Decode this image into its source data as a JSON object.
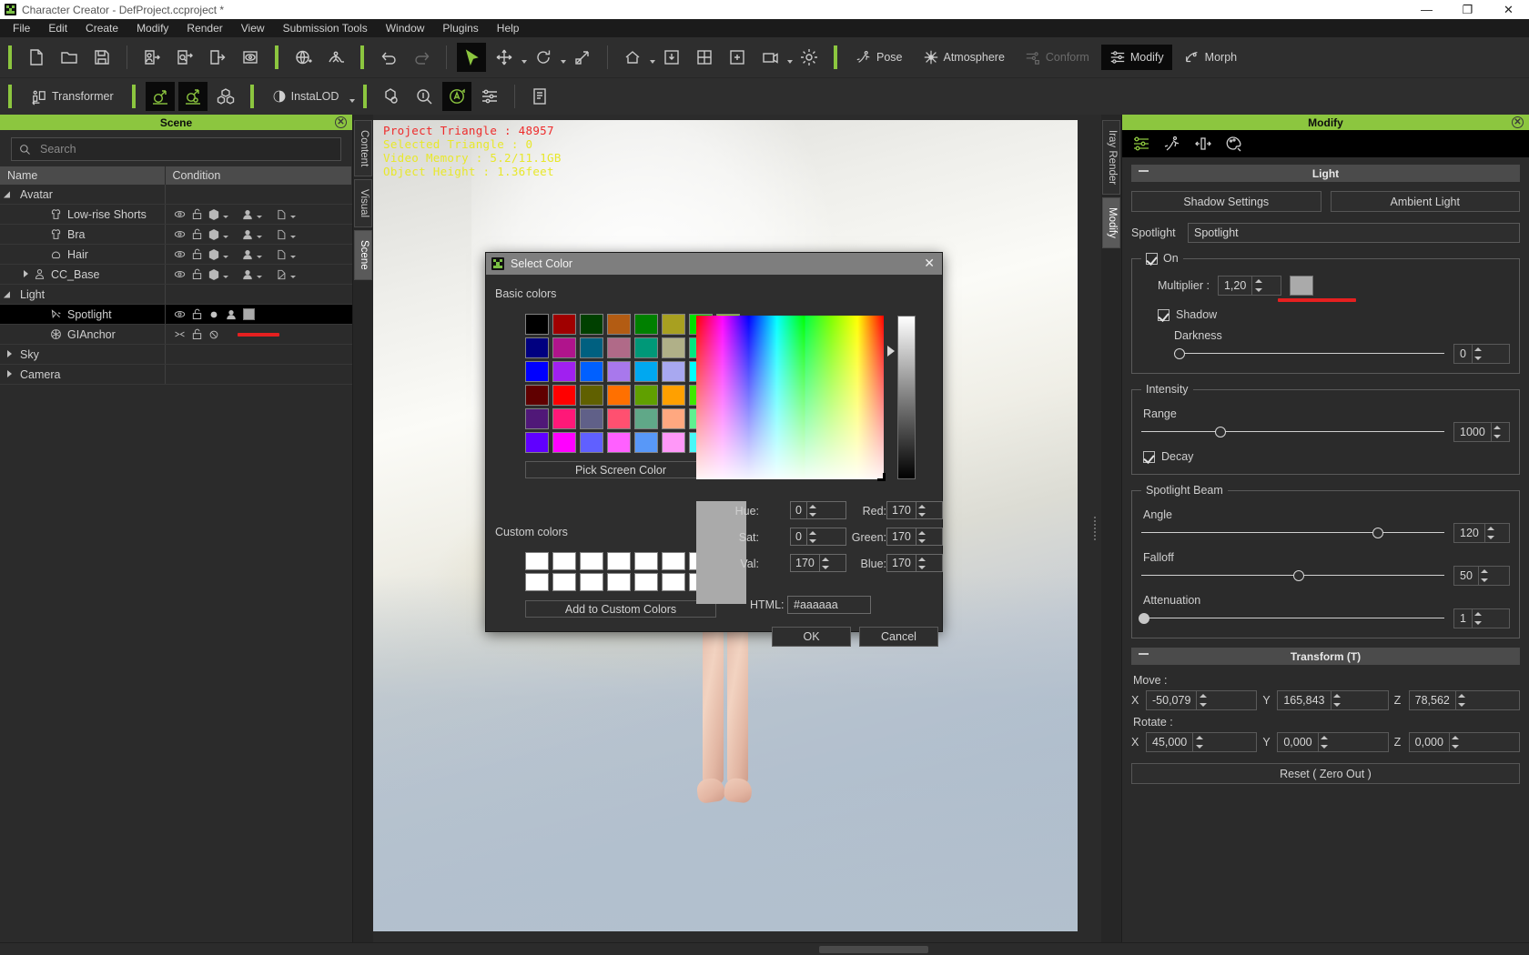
{
  "window": {
    "title": "Character Creator - DefProject.ccproject *",
    "minimize": "—",
    "maximize": "❐",
    "close": "✕"
  },
  "menubar": {
    "items": [
      "File",
      "Edit",
      "Create",
      "Modify",
      "Render",
      "View",
      "Submission Tools",
      "Window",
      "Plugins",
      "Help"
    ]
  },
  "toolbar_top": {
    "groups": [
      {
        "icons": [
          "new-document-icon",
          "open-folder-icon",
          "save-disk-icon"
        ]
      },
      {
        "icons": [
          "import-character-icon",
          "import-prop-icon",
          "export-icon",
          "preview-icon"
        ]
      },
      {
        "icons": [
          "globe-rotate-icon",
          "motion-path-icon"
        ]
      },
      {
        "icons": [
          "undo-icon",
          "redo-icon"
        ]
      }
    ],
    "select_icon": "cursor-arrow-icon",
    "move_icon": "move-gizmo-icon",
    "rotate_icon": "rotate-gizmo-icon",
    "scale_icon": "scale-gizmo-icon",
    "home_icon": "home-icon",
    "down_icon": "ground-icon",
    "grid_icon": "grid-icon",
    "frame_icon": "frame-icon",
    "camera_icon": "camera-icon",
    "light_icon": "light-sun-icon",
    "mode_buttons": [
      {
        "label": "Pose",
        "icon": "pose-icon",
        "state": "normal"
      },
      {
        "label": "Atmosphere",
        "icon": "atmosphere-icon",
        "state": "normal"
      },
      {
        "label": "Conform",
        "icon": "conform-icon",
        "state": "disabled"
      },
      {
        "label": "Modify",
        "icon": "modify-sliders-icon",
        "state": "active"
      },
      {
        "label": "Morph",
        "icon": "morph-icon",
        "state": "normal"
      }
    ]
  },
  "toolbar_second": {
    "transformer": {
      "label": "Transformer",
      "icon": "transformer-icon"
    },
    "gender_male_icon": "male-symbol-icon",
    "gender_female_icon": "female-symbol-icon",
    "mesh_icon": "mesh-cubes-icon",
    "instalod": {
      "label": "InstaLOD",
      "icon": "instalod-icon"
    },
    "extra_icons": [
      "material-ball-icon",
      "inspect-icon",
      "auto-setup-icon",
      "settings-sliders-icon",
      "script-icon"
    ]
  },
  "scene_panel": {
    "title": "Scene",
    "close_icon": "close-icon",
    "search": {
      "placeholder": "Search",
      "value": "",
      "icon": "search-icon"
    },
    "columns": [
      "Name",
      "Condition"
    ],
    "rows": [
      {
        "name": "Avatar",
        "indent": 0,
        "expander": "down",
        "icon": "",
        "selected": false,
        "condition": "none"
      },
      {
        "name": "Low-rise Shorts",
        "indent": 2,
        "expander": "",
        "icon": "cloth-icon",
        "selected": false,
        "condition": "full"
      },
      {
        "name": "Bra",
        "indent": 2,
        "expander": "",
        "icon": "cloth-icon",
        "selected": false,
        "condition": "full"
      },
      {
        "name": "Hair",
        "indent": 2,
        "expander": "",
        "icon": "hair-icon",
        "selected": false,
        "condition": "full"
      },
      {
        "name": "CC_Base",
        "indent": 1,
        "expander": "right",
        "icon": "person-icon",
        "selected": false,
        "condition": "full"
      },
      {
        "name": "Light",
        "indent": 0,
        "expander": "down",
        "icon": "",
        "selected": false,
        "condition": "none"
      },
      {
        "name": "Spotlight",
        "indent": 2,
        "expander": "",
        "icon": "spotlight-icon",
        "selected": true,
        "condition": "light"
      },
      {
        "name": "GIAnchor",
        "indent": 2,
        "expander": "",
        "icon": "gi-anchor-icon",
        "selected": false,
        "condition": "anchor"
      },
      {
        "name": "Sky",
        "indent": 0,
        "expander": "right",
        "icon": "",
        "selected": false,
        "condition": "none"
      },
      {
        "name": "Camera",
        "indent": 0,
        "expander": "right",
        "icon": "",
        "selected": false,
        "condition": "none"
      }
    ]
  },
  "vtabs_left": [
    {
      "label": "Content",
      "active": false
    },
    {
      "label": "Visual",
      "active": false
    },
    {
      "label": "Scene",
      "active": true
    }
  ],
  "vtabs_right": [
    {
      "label": "Iray Render",
      "active": false
    },
    {
      "label": "Modify",
      "active": true
    }
  ],
  "viewport": {
    "hud": [
      {
        "text": "Project Triangle : 48957",
        "color": "red"
      },
      {
        "text": "Selected Triangle : 0",
        "color": "yellow"
      },
      {
        "text": "Video Memory : 5.2/11.1GB",
        "color": "yellow"
      },
      {
        "text": "Object Height : 1.36feet",
        "color": "yellow"
      }
    ]
  },
  "modify_panel": {
    "title": "Modify",
    "close_icon": "close-icon",
    "tool_icons": [
      "sliders-icon",
      "pose-tool-icon",
      "align-icon",
      "palette-icon"
    ],
    "light_section": {
      "header": "Light",
      "collapse_icon": "minus-icon",
      "shadow_settings_label": "Shadow Settings",
      "ambient_light_label": "Ambient Light",
      "spotlight_label": "Spotlight",
      "spotlight_value": "Spotlight",
      "on_label": "On",
      "on_checked": true,
      "multiplier_label": "Multiplier :",
      "multiplier_value": "1,20",
      "multiplier_color": "#aaaaaa",
      "shadow_label": "Shadow",
      "shadow_checked": true,
      "darkness_label": "Darkness",
      "darkness_value": "0",
      "darkness_pct": 2,
      "intensity_legend": "Intensity",
      "range_label": "Range",
      "range_value": "1000",
      "range_pct": 26,
      "decay_label": "Decay",
      "decay_checked": true,
      "beam_legend": "Spotlight Beam",
      "angle_label": "Angle",
      "angle_value": "120",
      "angle_pct": 78,
      "falloff_label": "Falloff",
      "falloff_value": "50",
      "falloff_pct": 52,
      "attenuation_label": "Attenuation",
      "attenuation_value": "1",
      "attenuation_pct": 1
    },
    "transform_section": {
      "header": "Transform  (T)",
      "collapse_icon": "minus-icon",
      "move_label": "Move :",
      "move": {
        "x": "-50,079",
        "y": "165,843",
        "z": "78,562"
      },
      "rotate_label": "Rotate :",
      "rotate": {
        "x": "45,000",
        "y": "0,000",
        "z": "0,000"
      },
      "axis_labels": [
        "X",
        "Y",
        "Z"
      ],
      "reset_label": "Reset ( Zero Out )"
    }
  },
  "color_dialog": {
    "title": "Select Color",
    "close_icon": "close-icon",
    "basic_colors_label": "Basic colors",
    "basic_colors": [
      "#000000",
      "#a00000",
      "#004000",
      "#b35c13",
      "#008000",
      "#a8a020",
      "#00e000",
      "#80e000",
      "#000080",
      "#b0148c",
      "#006080",
      "#b06a88",
      "#009878",
      "#b0b088",
      "#00e880",
      "#a0e880",
      "#0000ff",
      "#a020f0",
      "#0060ff",
      "#a878ec",
      "#00a8f0",
      "#a8a8f0",
      "#00ffff",
      "#a0ffff",
      "#600000",
      "#ff0000",
      "#606000",
      "#ff7000",
      "#60a000",
      "#ffa000",
      "#40e800",
      "#ffff00",
      "#501878",
      "#ff1878",
      "#606088",
      "#ff5070",
      "#60a888",
      "#ffa880",
      "#60f090",
      "#ffeca0",
      "#6000ff",
      "#ff00ff",
      "#6060ff",
      "#ff60ff",
      "#5898f8",
      "#ff98f8",
      "#48f8f8",
      "#ffffff"
    ],
    "selected_basic_index": 47,
    "pick_screen_color_label": "Pick Screen Color",
    "custom_colors_label": "Custom colors",
    "custom_colors_count": 16,
    "add_to_custom_label": "Add to Custom Colors",
    "fields": {
      "hue_label": "Hue:",
      "hue_value": "0",
      "sat_label": "Sat:",
      "sat_value": "0",
      "val_label": "Val:",
      "val_value": "170",
      "red_label": "Red:",
      "red_value": "170",
      "green_label": "Green:",
      "green_value": "170",
      "blue_label": "Blue:",
      "blue_value": "170",
      "html_label": "HTML:",
      "html_value": "#aaaaaa"
    },
    "preview_color": "#aaaaaa",
    "ok_label": "OK",
    "cancel_label": "Cancel"
  },
  "colors": {
    "accent_green": "#8cc63f",
    "panel_bg": "#2b2b2b",
    "annotation_red": "#e52020"
  }
}
